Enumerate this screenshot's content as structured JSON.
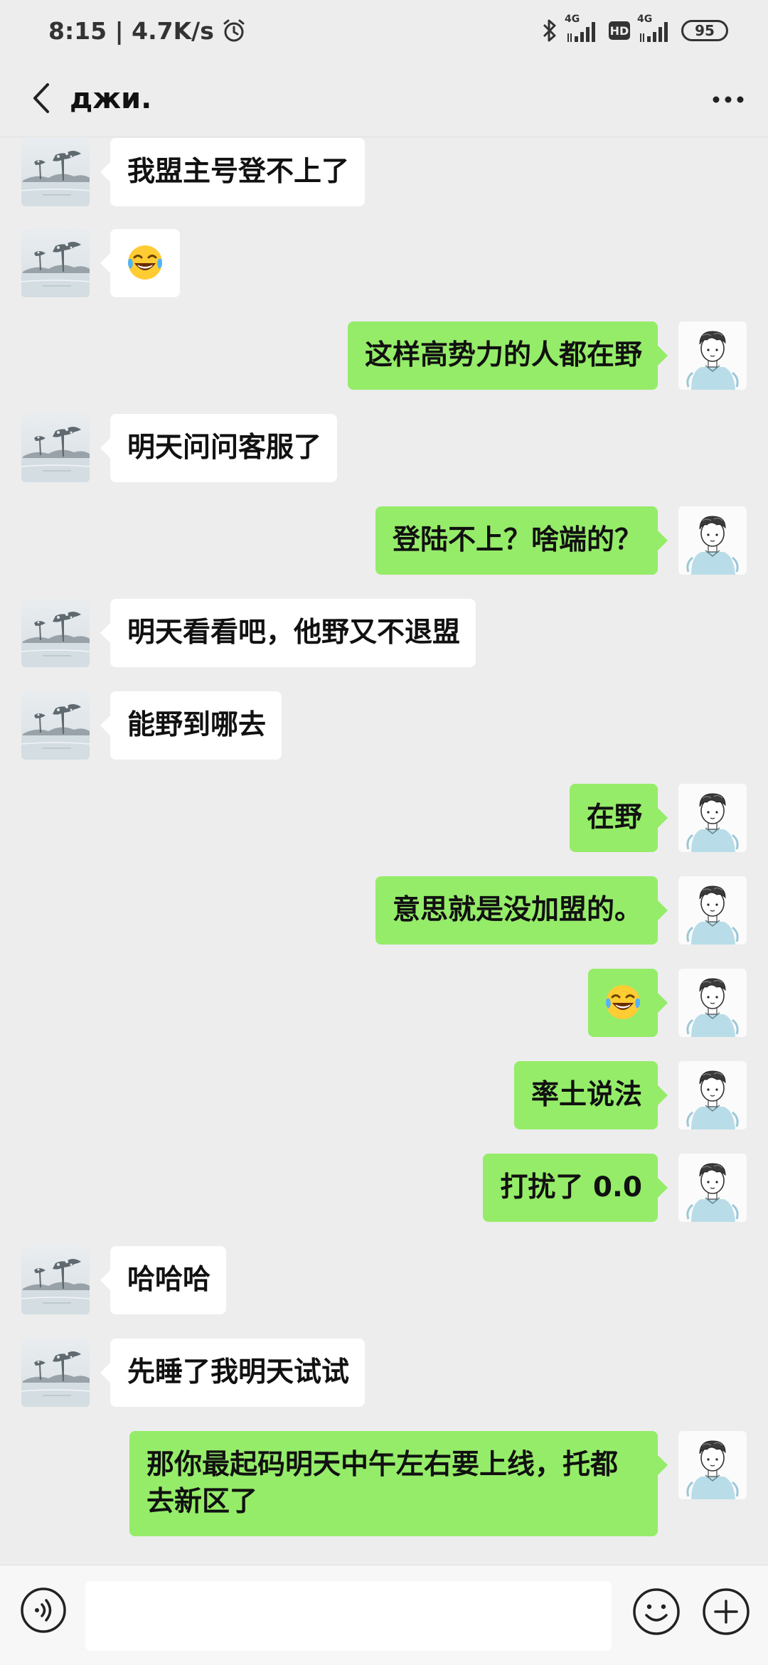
{
  "status_bar": {
    "time_speed": "8:15 | 4.7K/s",
    "signal1_label": "4G",
    "hd_label": "HD",
    "signal2_label": "4G",
    "battery": "95"
  },
  "header": {
    "title": "джи."
  },
  "messages": [
    {
      "from": "other",
      "text": "我盟主号登不上了"
    },
    {
      "from": "other",
      "text": "",
      "emoji": "laughing-crying-emoji"
    },
    {
      "from": "me",
      "text": "这样高势力的人都在野"
    },
    {
      "from": "other",
      "text": "明天问问客服了"
    },
    {
      "from": "me",
      "text": "登陆不上？啥端的？"
    },
    {
      "from": "other",
      "text": "明天看看吧，他野又不退盟"
    },
    {
      "from": "other",
      "text": "能野到哪去"
    },
    {
      "from": "me",
      "text": "在野"
    },
    {
      "from": "me",
      "text": "意思就是没加盟的。"
    },
    {
      "from": "me",
      "text": "",
      "emoji": "laughing-crying-emoji"
    },
    {
      "from": "me",
      "text": "率土说法"
    },
    {
      "from": "me",
      "text": "打扰了 0.0"
    },
    {
      "from": "other",
      "text": "哈哈哈"
    },
    {
      "from": "other",
      "text": "先睡了我明天试试"
    },
    {
      "from": "me",
      "text": "那你最起码明天中午左右要上线，托都去新区了"
    }
  ],
  "input_bar": {
    "placeholder": ""
  },
  "colors": {
    "background": "#ededed",
    "my_bubble": "#95ec69",
    "other_bubble": "#ffffff"
  }
}
